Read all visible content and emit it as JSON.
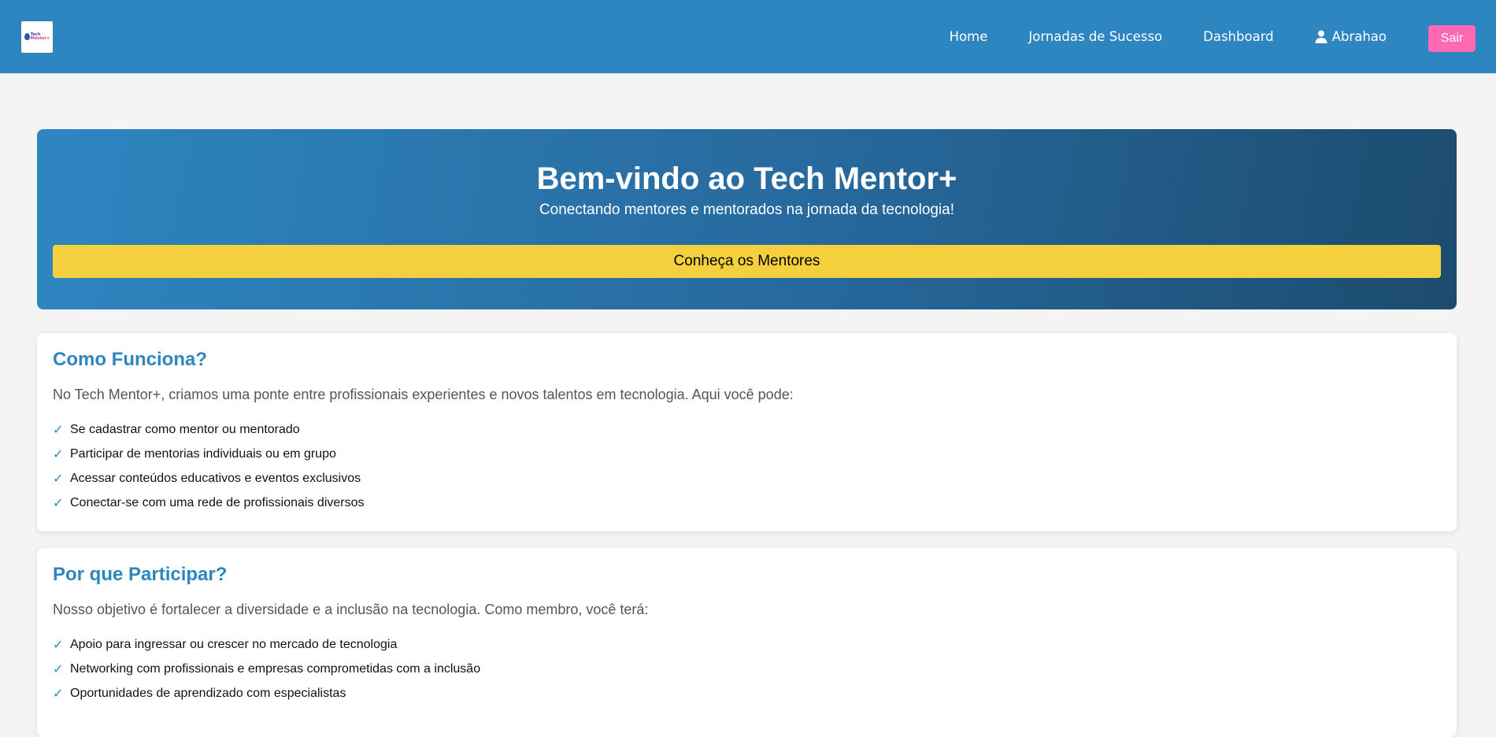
{
  "navbar": {
    "logo_line1": "Tech",
    "logo_line2": "Mentor+",
    "links": [
      {
        "label": "Home"
      },
      {
        "label": "Jornadas de Sucesso"
      },
      {
        "label": "Dashboard"
      }
    ],
    "user_name": "Abrahao",
    "user_icon": "user-icon",
    "logout_label": "Sair"
  },
  "hero": {
    "title": "Bem-vindo ao Tech Mentor+",
    "subtitle": "Conectando mentores e mentorados na jornada da tecnologia!",
    "cta_label": "Conheça os Mentores"
  },
  "how_it_works": {
    "title": "Como Funciona?",
    "intro": "No Tech Mentor+, criamos uma ponte entre profissionais experientes e novos talentos em tecnologia. Aqui você pode:",
    "items": [
      "Se cadastrar como mentor ou mentorado",
      "Participar de mentorias individuais ou em grupo",
      "Acessar conteúdos educativos e eventos exclusivos",
      "Conectar-se com uma rede de profissionais diversos"
    ]
  },
  "why_participate": {
    "title": "Por que Participar?",
    "intro": "Nosso objetivo é fortalecer a diversidade e a inclusão na tecnologia. Como membro, você terá:",
    "items": [
      "Apoio para ingressar ou crescer no mercado de tecnologia",
      "Networking com profissionais e empresas comprometidas com a inclusão",
      "Oportunidades de aprendizado com especialistas"
    ]
  },
  "check_glyph": "✓",
  "colors": {
    "primary": "#2e86c1",
    "hero_gradient_end": "#1c4b6e",
    "cta": "#f4d03f",
    "logout": "#ff69b4",
    "background": "#f4f4f4"
  }
}
